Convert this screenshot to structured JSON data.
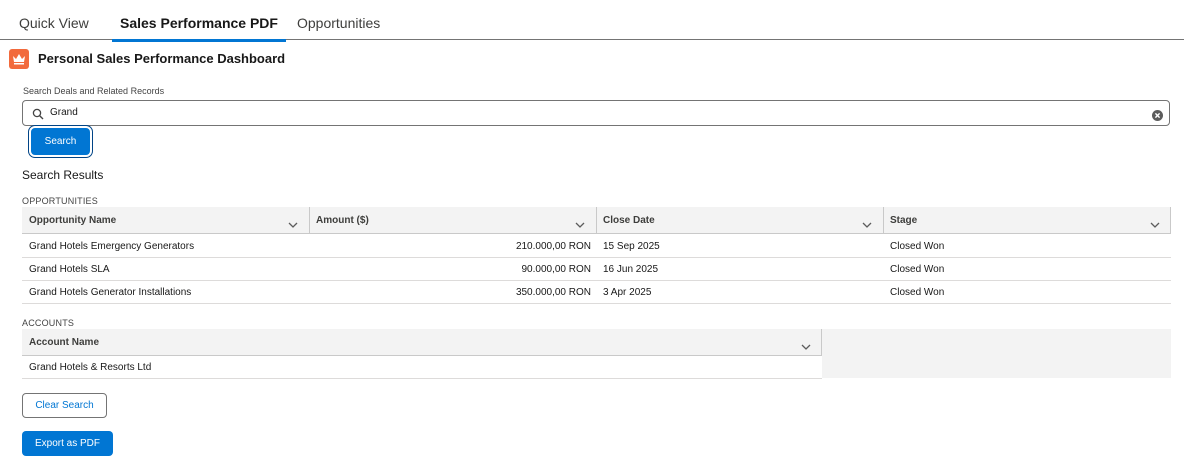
{
  "tabs": [
    {
      "label": "Quick View"
    },
    {
      "label": "Sales Performance PDF"
    },
    {
      "label": "Opportunities"
    }
  ],
  "header": {
    "title": "Personal Sales Performance Dashboard",
    "icon": "crown-icon",
    "icon_color": "#f26a3c"
  },
  "search": {
    "label": "Search Deals and Related Records",
    "value": "Grand",
    "button_label": "Search"
  },
  "results": {
    "title": "Search Results",
    "opportunities": {
      "section_label": "OPPORTUNITIES",
      "columns": [
        "Opportunity Name",
        "Amount ($)",
        "Close Date",
        "Stage"
      ],
      "rows": [
        {
          "name": "Grand Hotels Emergency Generators",
          "amount": "210.000,00 RON",
          "close_date": "15 Sep 2025",
          "stage": "Closed Won"
        },
        {
          "name": "Grand Hotels SLA",
          "amount": "90.000,00 RON",
          "close_date": "16 Jun 2025",
          "stage": "Closed Won"
        },
        {
          "name": "Grand Hotels Generator Installations",
          "amount": "350.000,00 RON",
          "close_date": "3 Apr 2025",
          "stage": "Closed Won"
        }
      ]
    },
    "accounts": {
      "section_label": "ACCOUNTS",
      "columns": [
        "Account Name"
      ],
      "rows": [
        {
          "name": "Grand Hotels & Resorts Ltd"
        }
      ]
    }
  },
  "actions": {
    "clear_label": "Clear Search",
    "export_label": "Export as PDF"
  },
  "colors": {
    "brand": "#0176d3",
    "header_bg": "#f3f3f3"
  }
}
